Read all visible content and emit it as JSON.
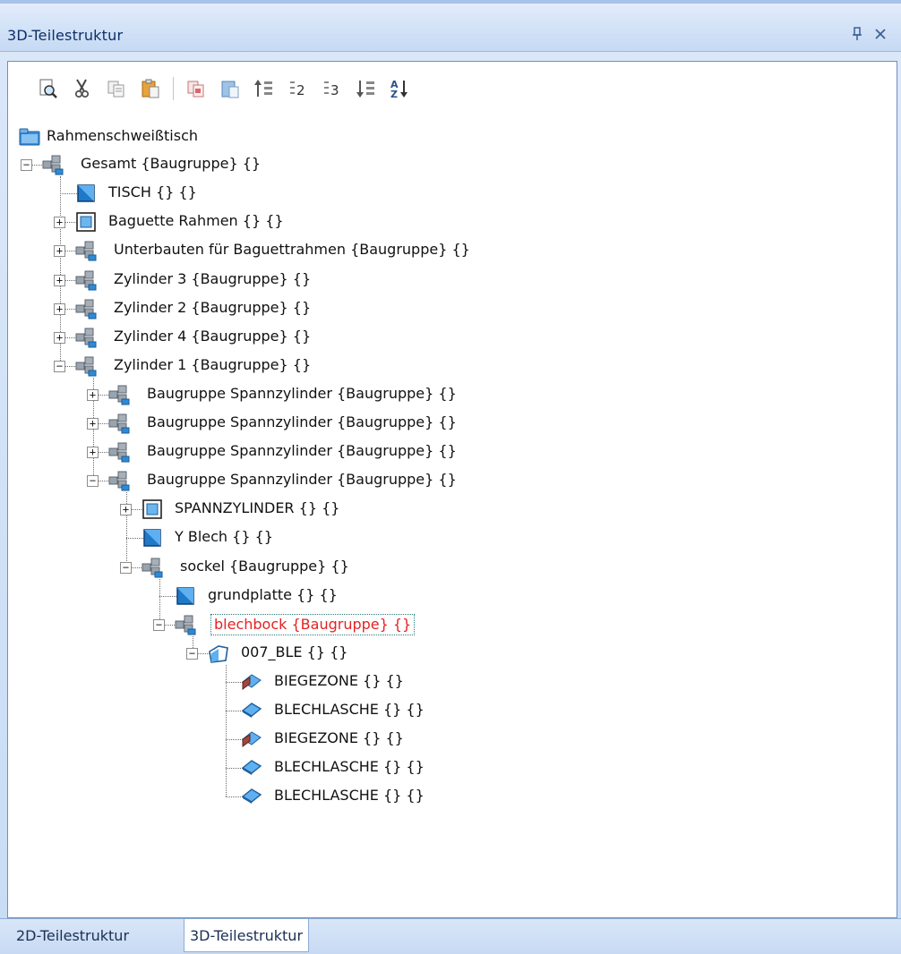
{
  "window": {
    "title": "3D-Teilestruktur",
    "pin_glyph": "ᵖ",
    "close_glyph": "✕"
  },
  "toolbar": {
    "items": [
      {
        "icon": "print-preview-icon"
      },
      {
        "icon": "cut-icon"
      },
      {
        "icon": "copy-icon"
      },
      {
        "icon": "paste-icon"
      },
      {
        "icon": "copy-structure-icon"
      },
      {
        "icon": "paste-structure-icon"
      },
      {
        "icon": "sort-top-icon"
      },
      {
        "icon": "level-2-icon",
        "text": "2"
      },
      {
        "icon": "level-3-icon",
        "text": "3"
      },
      {
        "icon": "sort-bottom-icon"
      },
      {
        "icon": "sort-az-icon",
        "text": "AZ"
      }
    ]
  },
  "tree": {
    "root": "Rahmenschweißtisch",
    "nodes": [
      {
        "label": "Gesamt {Baugruppe} {}",
        "icon": "assembly"
      },
      {
        "label": "TISCH {} {}",
        "icon": "part"
      },
      {
        "label": "Baguette Rahmen {} {}",
        "icon": "subpart"
      },
      {
        "label": "Unterbauten für Baguettrahmen {Baugruppe} {}",
        "icon": "assembly"
      },
      {
        "label": "Zylinder 3 {Baugruppe} {}",
        "icon": "assembly"
      },
      {
        "label": "Zylinder 2 {Baugruppe} {}",
        "icon": "assembly"
      },
      {
        "label": "Zylinder 4 {Baugruppe} {}",
        "icon": "assembly"
      },
      {
        "label": "Zylinder 1 {Baugruppe} {}",
        "icon": "assembly"
      },
      {
        "label": "Baugruppe Spannzylinder {Baugruppe} {}",
        "icon": "assembly"
      },
      {
        "label": "Baugruppe Spannzylinder {Baugruppe} {}",
        "icon": "assembly"
      },
      {
        "label": "Baugruppe Spannzylinder {Baugruppe} {}",
        "icon": "assembly"
      },
      {
        "label": "Baugruppe Spannzylinder {Baugruppe} {}",
        "icon": "assembly"
      },
      {
        "label": "SPANNZYLINDER {} {}",
        "icon": "subpart"
      },
      {
        "label": "Y Blech {} {}",
        "icon": "part"
      },
      {
        "label": "sockel {Baugruppe} {}",
        "icon": "assembly"
      },
      {
        "label": "grundplatte {} {}",
        "icon": "part"
      },
      {
        "label": "blechbock {Baugruppe} {}",
        "icon": "assembly",
        "selected": true
      },
      {
        "label": "007_BLE {} {}",
        "icon": "sheetmetal"
      },
      {
        "label": "BIEGEZONE {} {}",
        "icon": "bendzone"
      },
      {
        "label": "BLECHLASCHE {} {}",
        "icon": "flange"
      },
      {
        "label": "BIEGEZONE {} {}",
        "icon": "bendzone"
      },
      {
        "label": "BLECHLASCHE {} {}",
        "icon": "flange"
      },
      {
        "label": "BLECHLASCHE {} {}",
        "icon": "flange"
      }
    ]
  },
  "tabs": [
    {
      "label": "2D-Teilestruktur",
      "active": false
    },
    {
      "label": "3D-Teilestruktur",
      "active": true
    }
  ],
  "colors": {
    "selected_text": "#e52222",
    "title_text": "#0f2f66",
    "part_blue": "#1f79c9"
  }
}
